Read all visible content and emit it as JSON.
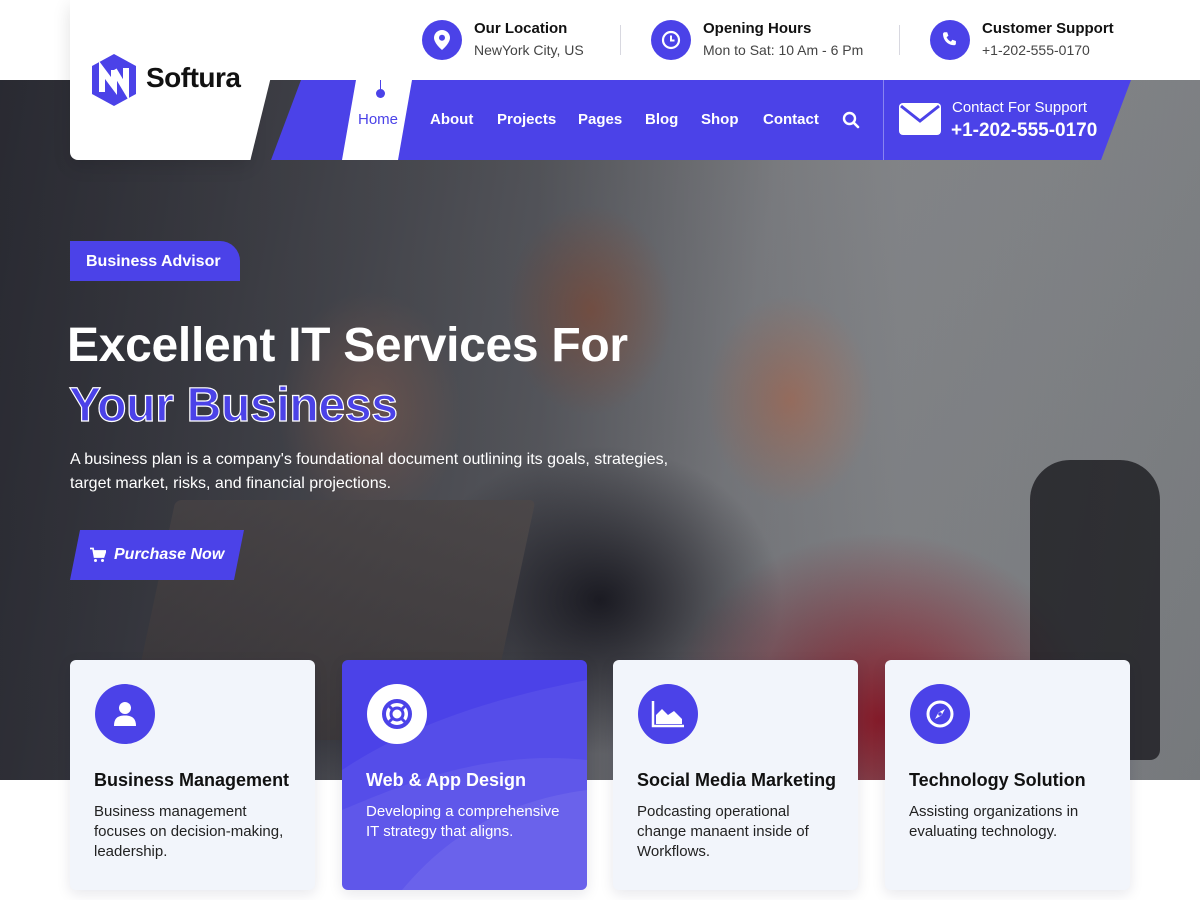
{
  "brand": {
    "name": "Softura",
    "accent": "#4b42e8"
  },
  "topbar": {
    "location": {
      "title": "Our Location",
      "value": "NewYork City, US",
      "icon": "location-pin-icon"
    },
    "hours": {
      "title": "Opening Hours",
      "value": "Mon to Sat: 10 Am - 6 Pm",
      "icon": "clock-icon"
    },
    "support": {
      "title": "Customer Support",
      "value": "+1-202-555-0170",
      "icon": "phone-icon"
    }
  },
  "nav": {
    "items": [
      {
        "label": "Home",
        "active": true
      },
      {
        "label": "About"
      },
      {
        "label": "Projects"
      },
      {
        "label": "Pages"
      },
      {
        "label": "Blog"
      },
      {
        "label": "Shop"
      },
      {
        "label": "Contact"
      }
    ],
    "search_icon": "search-icon",
    "support_label": "Contact For Support",
    "support_phone": "+1-202-555-0170",
    "support_icon": "envelope-icon"
  },
  "hero": {
    "badge": "Business Advisor",
    "headline_line1": "Excellent IT Services For",
    "headline_line2": "Your Business",
    "description": "A business plan is a company's foundational document outlining its goals, strategies, target market, risks, and financial projections.",
    "cta_label": "Purchase Now",
    "cta_icon": "cart-icon"
  },
  "services": [
    {
      "title": "Business Management",
      "description": "Business management focuses on decision-making, leadership.",
      "icon": "user-icon",
      "active": false
    },
    {
      "title": "Web & App Design",
      "description": "Developing a comprehensive IT strategy that aligns.",
      "icon": "lifebuoy-icon",
      "active": true
    },
    {
      "title": "Social Media Marketing",
      "description": "Podcasting operational change manaent inside of Workflows.",
      "icon": "area-chart-icon",
      "active": false
    },
    {
      "title": "Technology Solution",
      "description": "Assisting organizations in evaluating technology.",
      "icon": "compass-icon",
      "active": false
    }
  ]
}
